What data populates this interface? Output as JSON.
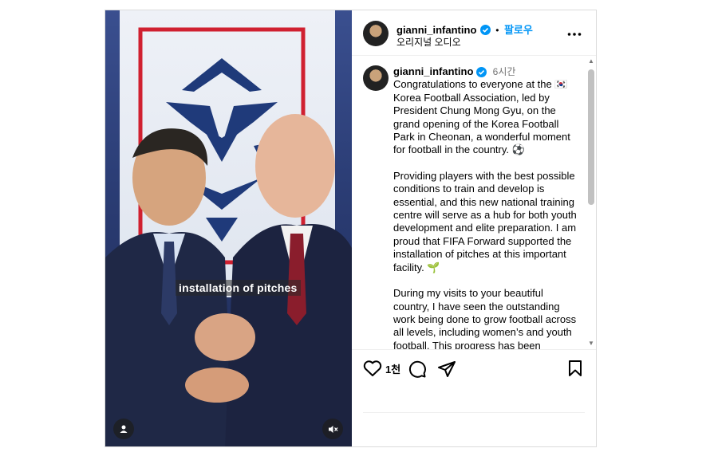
{
  "media": {
    "overlay_text": "installation of pitches",
    "profile_icon": "person-icon",
    "sound_icon": "volume-muted-icon"
  },
  "header": {
    "username": "gianni_infantino",
    "separator": "•",
    "follow_label": "팔로우",
    "audio_label": "오리지널 오디오",
    "more_icon": "more-horizontal-icon"
  },
  "caption": {
    "username": "gianni_infantino",
    "time": "6시간",
    "paragraphs": [
      "Congratulations to everyone at the 🇰🇷 Korea Football Association, led by President Chung Mong Gyu, on the grand opening of the Korea Football Park in Cheonan, a wonderful moment for football in the country. ⚽",
      "Providing players with the best possible conditions to train and develop is essential, and this new national training centre will serve as a hub for both youth development and elite preparation. I am proud that FIFA Forward supported the installation of pitches at this important facility. 🌱",
      "During my visits to your beautiful country, I have seen the outstanding work being done to grow football across all levels, including women’s and youth football. This progress has been"
    ]
  },
  "actions": {
    "like_count": "1천",
    "icons": [
      "heart-icon",
      "comment-icon",
      "share-icon",
      "bookmark-icon"
    ]
  },
  "colors": {
    "accent": "#0095f6",
    "verified": "#0095f6",
    "muted": "#737373"
  }
}
